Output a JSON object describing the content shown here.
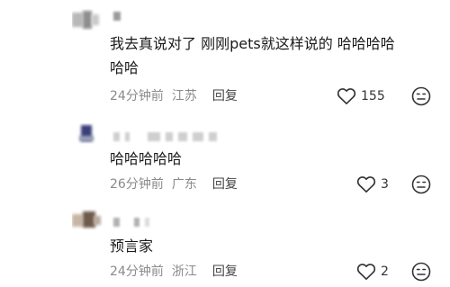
{
  "comments": [
    {
      "text_line1": "我去真说对了 刚刚pets就这样说的 哈哈哈哈",
      "text_line2": "哈哈",
      "time": "24分钟前",
      "location": "江苏",
      "reply_label": "回复",
      "likes": "155",
      "like_icon": "heart-outline-icon",
      "dislike_icon": "frown-icon"
    },
    {
      "text_line1": "哈哈哈哈哈",
      "time": "26分钟前",
      "location": "广东",
      "reply_label": "回复",
      "likes": "3",
      "like_icon": "heart-outline-icon",
      "dislike_icon": "frown-icon"
    },
    {
      "text_line1": "预言家",
      "time": "24分钟前",
      "location": "浙江",
      "reply_label": "回复",
      "likes": "2",
      "like_icon": "heart-outline-icon",
      "dislike_icon": "frown-icon"
    }
  ]
}
